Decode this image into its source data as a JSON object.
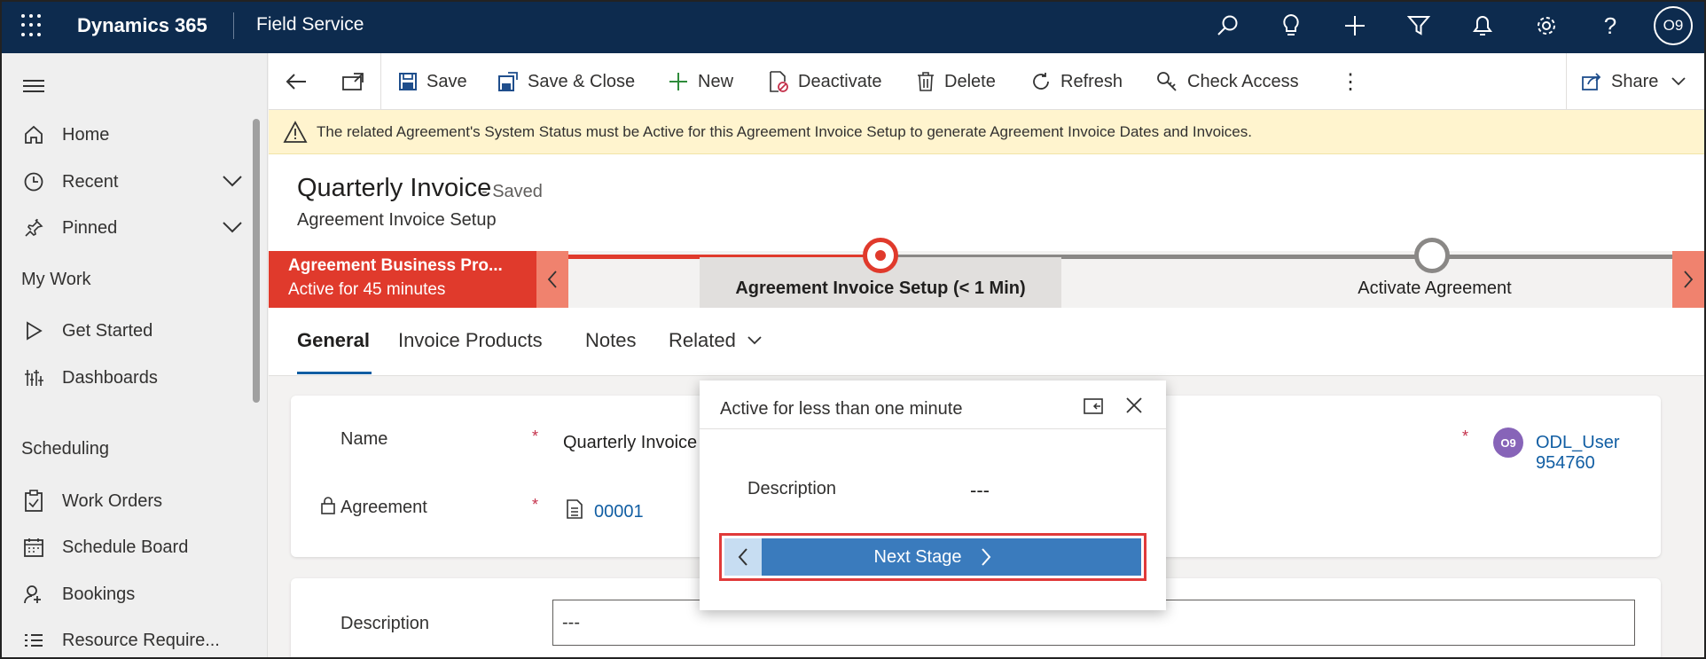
{
  "topbar": {
    "brand": "Dynamics 365",
    "app": "Field Service",
    "user_initials": "O9"
  },
  "sidebar": {
    "items": [
      {
        "label": "Home"
      },
      {
        "label": "Recent"
      },
      {
        "label": "Pinned"
      }
    ],
    "my_work_heading": "My Work",
    "my_work_items": [
      {
        "label": "Get Started"
      },
      {
        "label": "Dashboards"
      }
    ],
    "scheduling_heading": "Scheduling",
    "scheduling_items": [
      {
        "label": "Work Orders"
      },
      {
        "label": "Schedule Board"
      },
      {
        "label": "Bookings"
      },
      {
        "label": "Resource Require..."
      }
    ]
  },
  "commands": {
    "save": "Save",
    "save_close": "Save & Close",
    "new": "New",
    "deactivate": "Deactivate",
    "delete": "Delete",
    "refresh": "Refresh",
    "check_access": "Check Access",
    "share": "Share"
  },
  "warning": "The related Agreement's System Status must be Active for this Agreement Invoice Setup to generate Agreement Invoice Dates and Invoices.",
  "header": {
    "title": "Quarterly Invoice",
    "status": "- Saved",
    "entity": "Agreement Invoice Setup"
  },
  "bpf": {
    "name": "Agreement Business Pro...",
    "duration": "Active for 45 minutes",
    "active_stage": "Agreement Invoice Setup  (< 1 Min)",
    "next_stage": "Activate Agreement"
  },
  "tabs": [
    {
      "label": "General"
    },
    {
      "label": "Invoice Products"
    },
    {
      "label": "Notes"
    },
    {
      "label": "Related"
    }
  ],
  "form": {
    "name_label": "Name",
    "name_value": "Quarterly Invoice",
    "agreement_label": "Agreement",
    "agreement_value": "00001",
    "owner_initials": "O9",
    "owner_value": "ODL_User 954760",
    "description_label": "Description",
    "description_value": "---"
  },
  "flyout": {
    "title": "Active for less than one minute",
    "desc_label": "Description",
    "desc_value": "---",
    "next_stage_label": "Next Stage"
  },
  "colors": {
    "topbar": "#0d2b4e",
    "accent_red": "#e03a2c",
    "link_blue": "#115ea3",
    "warning_bg": "#fff4ce",
    "next_button": "#3a7bbd"
  }
}
